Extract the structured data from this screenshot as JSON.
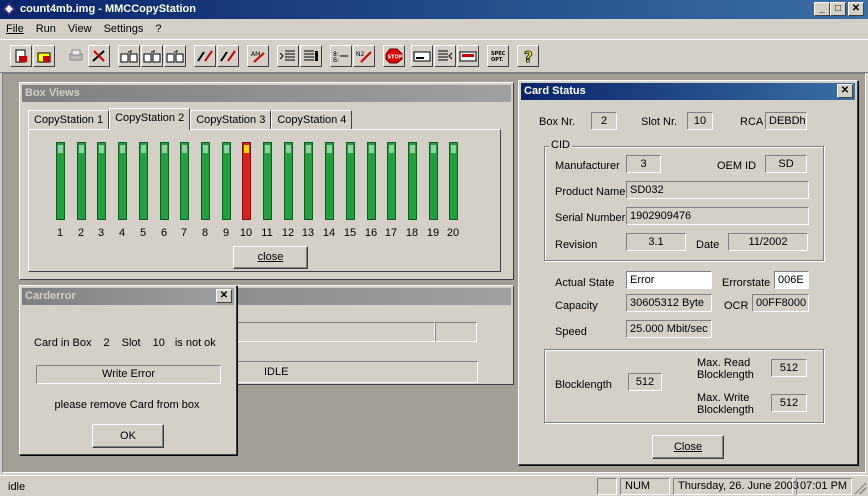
{
  "window": {
    "title": "count4mb.img - MMCCopyStation"
  },
  "menu": [
    "File",
    "Run",
    "View",
    "Settings",
    "?"
  ],
  "toolbar": {
    "icons": [
      "new-doc-icon",
      "open-icon",
      "print-icon",
      "tools-icon",
      "copy-1-icon",
      "copy-2-icon",
      "copy-3-icon",
      "pen-icon",
      "pen-red-icon",
      "pen-blue-icon",
      "list-in-icon",
      "list-out-icon",
      "sort-icon",
      "edit-icon",
      "stop-icon",
      "drive-icon",
      "list-icon",
      "card-icon",
      "spec-icon",
      "help-icon"
    ],
    "stop_label": "STOP",
    "spec_label": "SPEC\nOPT."
  },
  "box_views": {
    "title": "Box Views",
    "tabs": [
      "CopyStation 1",
      "CopyStation 2",
      "CopyStation 3",
      "CopyStation 4"
    ],
    "active_tab": 1,
    "slots": [
      "1",
      "2",
      "3",
      "4",
      "5",
      "6",
      "7",
      "8",
      "9",
      "10",
      "11",
      "12",
      "13",
      "14",
      "15",
      "16",
      "17",
      "18",
      "19",
      "20"
    ],
    "error_slot": "10",
    "close_label": "close",
    "status_text": "IDLE"
  },
  "carderror": {
    "title": "Carderror",
    "line_prefix": "Card in Box",
    "box": "2",
    "slot_label": "Slot",
    "slot": "10",
    "line_suffix": "is not ok",
    "error_text": "Write Error",
    "message": "please remove Card from box",
    "ok_label": "OK"
  },
  "card_status": {
    "title": "Card Status",
    "box_label": "Box Nr.",
    "box_value": "2",
    "slot_label": "Slot Nr.",
    "slot_value": "10",
    "rca_label": "RCA",
    "rca_value": "DEBDh",
    "cid_label": "CID",
    "manufacturer_label": "Manufacturer",
    "manufacturer_value": "3",
    "oem_label": "OEM ID",
    "oem_value": "SD",
    "product_label": "Product Name",
    "product_value": "SD032",
    "serial_label": "Serial Number",
    "serial_value": "1902909476",
    "revision_label": "Revision",
    "revision_value": "3.1",
    "date_label": "Date",
    "date_value": "11/2002",
    "state_label": "Actual State",
    "state_value": "Error",
    "errorstate_label": "Errorstate",
    "errorstate_value": "006E",
    "capacity_label": "Capacity",
    "capacity_value": "30605312 Byte",
    "ocr_label": "OCR",
    "ocr_value": "00FF8000",
    "speed_label": "Speed",
    "speed_value": "25.000 Mbit/sec",
    "blocklength_label": "Blocklength",
    "blocklength_value": "512",
    "maxread_label": "Max. Read\nBlocklength",
    "maxread_value": "512",
    "maxwrite_label": "Max. Write\nBlocklength",
    "maxwrite_value": "512",
    "close_label": "Close"
  },
  "statusbar": {
    "left": "idle",
    "num": "NUM",
    "datetime": "Thursday, 26. June 2003",
    "time": "07:01 PM"
  }
}
